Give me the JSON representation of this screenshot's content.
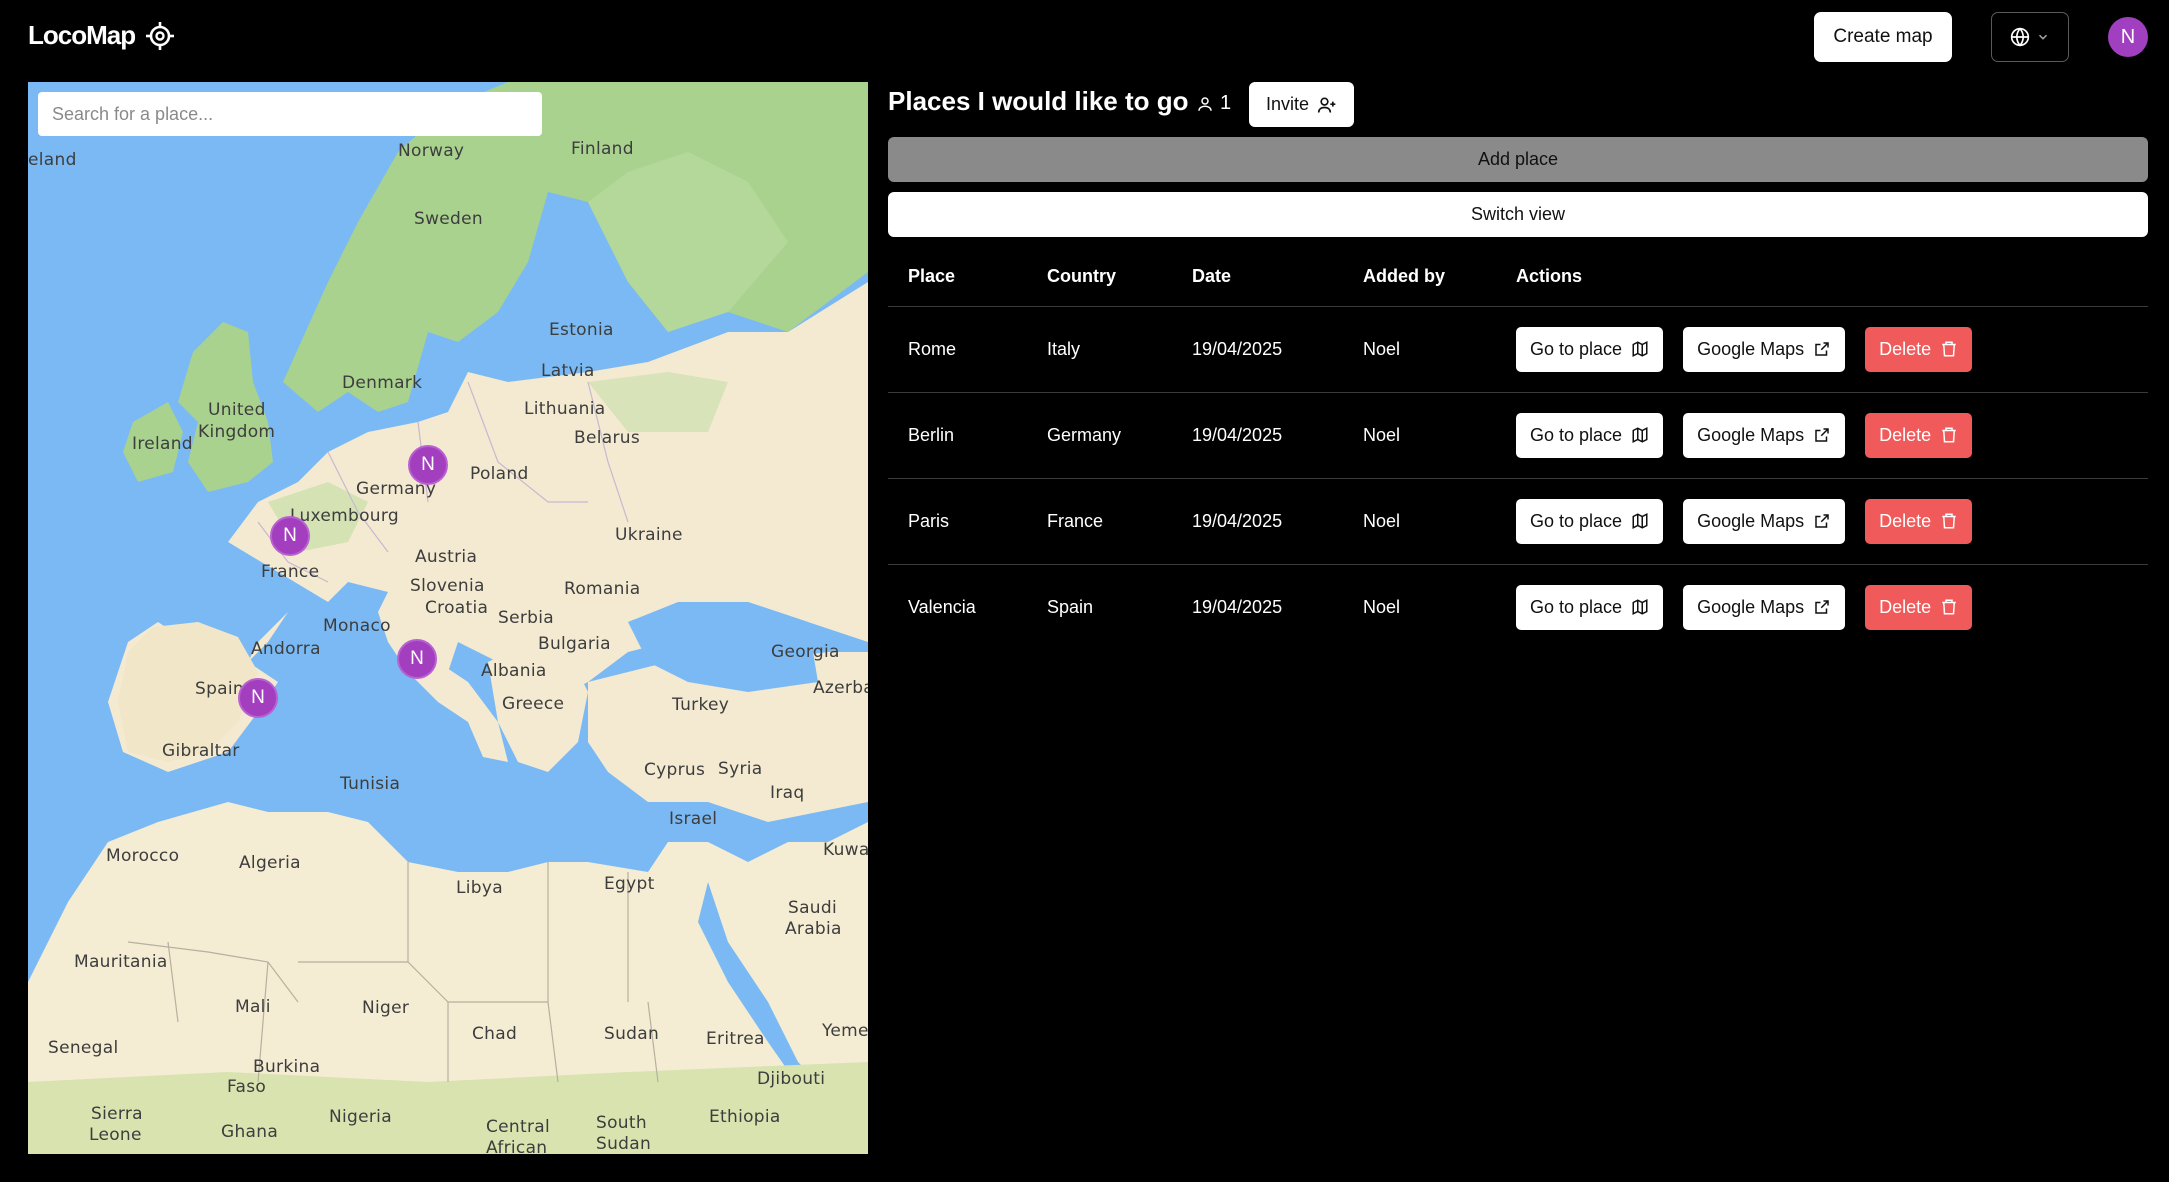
{
  "app": {
    "name": "LocoMap"
  },
  "header": {
    "create_map_label": "Create map",
    "avatar_initial": "N"
  },
  "map": {
    "search_placeholder": "Search for a place...",
    "labels": {
      "iceland": "eland",
      "norway": "Norway",
      "finland": "Finland",
      "sweden": "Sweden",
      "estonia": "Estonia",
      "denmark": "Denmark",
      "latvia": "Latvia",
      "lithuania": "Lithuania",
      "united": "United",
      "kingdom": "Kingdom",
      "ireland": "Ireland",
      "belarus": "Belarus",
      "poland": "Poland",
      "germany": "Germany",
      "luxembourg": "Luxembourg",
      "ukraine": "Ukraine",
      "france": "France",
      "austria": "Austria",
      "slovenia": "Slovenia",
      "romania": "Romania",
      "croatia": "Croatia",
      "serbia": "Serbia",
      "monaco": "Monaco",
      "bulgaria": "Bulgaria",
      "andorra": "Andorra",
      "georgia": "Georgia",
      "albania": "Albania",
      "spain": "Spain",
      "azerba": "Azerba",
      "greece": "Greece",
      "turkey": "Turkey",
      "gibraltar": "Gibraltar",
      "cyprus": "Cyprus",
      "syria": "Syria",
      "tunisia": "Tunisia",
      "iraq": "Iraq",
      "israel": "Israel",
      "kuwa": "Kuwa",
      "morocco": "Morocco",
      "algeria": "Algeria",
      "libya": "Libya",
      "egypt": "Egypt",
      "saudi": "Saudi",
      "arabia": "Arabia",
      "mauritania": "Mauritania",
      "mali": "Mali",
      "niger": "Niger",
      "chad": "Chad",
      "sudan": "Sudan",
      "eritrea": "Eritrea",
      "yeme": "Yeme",
      "senegal": "Senegal",
      "burkina": "Burkina",
      "faso": "Faso",
      "djibouti": "Djibouti",
      "sierra": "Sierra",
      "leone": "Leone",
      "nigeria": "Nigeria",
      "ethiopia": "Ethiopia",
      "ghana": "Ghana",
      "central": "Central",
      "african": "African",
      "south": "South",
      "south_sudan": "Sudan"
    },
    "marker_initial": "N"
  },
  "panel": {
    "title": "Places I would like to go",
    "member_count": "1",
    "invite_label": "Invite",
    "add_place_label": "Add place",
    "switch_view_label": "Switch view"
  },
  "table": {
    "headers": {
      "place": "Place",
      "country": "Country",
      "date": "Date",
      "added_by": "Added by",
      "actions": "Actions"
    },
    "action_labels": {
      "go": "Go to place",
      "maps": "Google Maps",
      "delete": "Delete"
    },
    "rows": [
      {
        "place": "Rome",
        "country": "Italy",
        "date": "19/04/2025",
        "added_by": "Noel"
      },
      {
        "place": "Berlin",
        "country": "Germany",
        "date": "19/04/2025",
        "added_by": "Noel"
      },
      {
        "place": "Paris",
        "country": "France",
        "date": "19/04/2025",
        "added_by": "Noel"
      },
      {
        "place": "Valencia",
        "country": "Spain",
        "date": "19/04/2025",
        "added_by": "Noel"
      }
    ]
  },
  "colors": {
    "background": "#000000",
    "accent": "#a03fc0",
    "delete": "#f05a5a",
    "add_place": "#8a8a8a",
    "sea": "#7ab9f3",
    "land": "#f3ead1",
    "forest": "#a6d08c"
  },
  "icons": {
    "logo": "crosshair-icon",
    "language": "globe-icon",
    "members": "user-icon",
    "invite": "user-plus-icon",
    "go": "map-icon",
    "maps": "external-link-icon",
    "delete": "trash-icon"
  }
}
